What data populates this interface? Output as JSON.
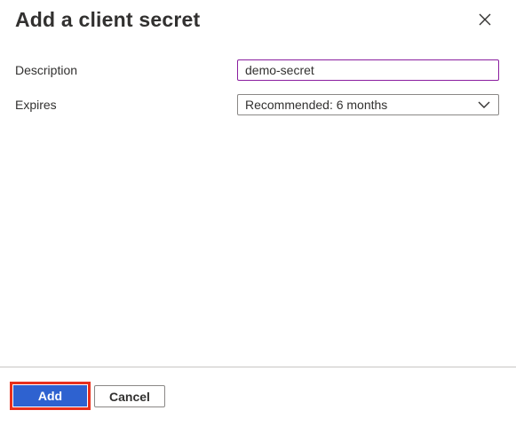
{
  "dialog": {
    "title": "Add a client secret",
    "close_icon": "close-icon"
  },
  "form": {
    "description": {
      "label": "Description",
      "value": "demo-secret"
    },
    "expires": {
      "label": "Expires",
      "selected": "Recommended: 6 months",
      "icon": "chevron-down-icon"
    }
  },
  "footer": {
    "add_label": "Add",
    "cancel_label": "Cancel"
  },
  "colors": {
    "primary": "#2e62d0",
    "highlight_border": "#e8301d",
    "focus_border": "#8a1e9f"
  }
}
